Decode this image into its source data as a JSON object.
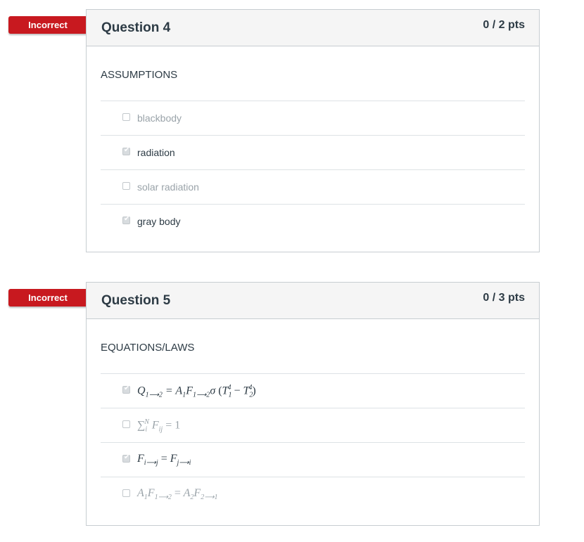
{
  "questions": [
    {
      "status": "Incorrect",
      "title": "Question 4",
      "points": "0 / 2 pts",
      "text": "ASSUMPTIONS",
      "answers": [
        {
          "label": "blackbody",
          "checked": false
        },
        {
          "label": "radiation",
          "checked": true
        },
        {
          "label": "solar radiation",
          "checked": false
        },
        {
          "label": "gray body",
          "checked": true
        }
      ]
    },
    {
      "status": "Incorrect",
      "title": "Question 5",
      "points": "0 / 3 pts",
      "text": "EQUATIONS/LAWS",
      "answers": [
        {
          "label": "Q1⟶2 = A1F1⟶2σ (T1^4 − T2^4)",
          "checked": true
        },
        {
          "label": "∑i^N Fij = 1",
          "checked": false
        },
        {
          "label": "Fi⟶j = Fj⟶i",
          "checked": true
        },
        {
          "label": "A1F1⟶2 = A2F2⟶1",
          "checked": false
        }
      ]
    }
  ]
}
